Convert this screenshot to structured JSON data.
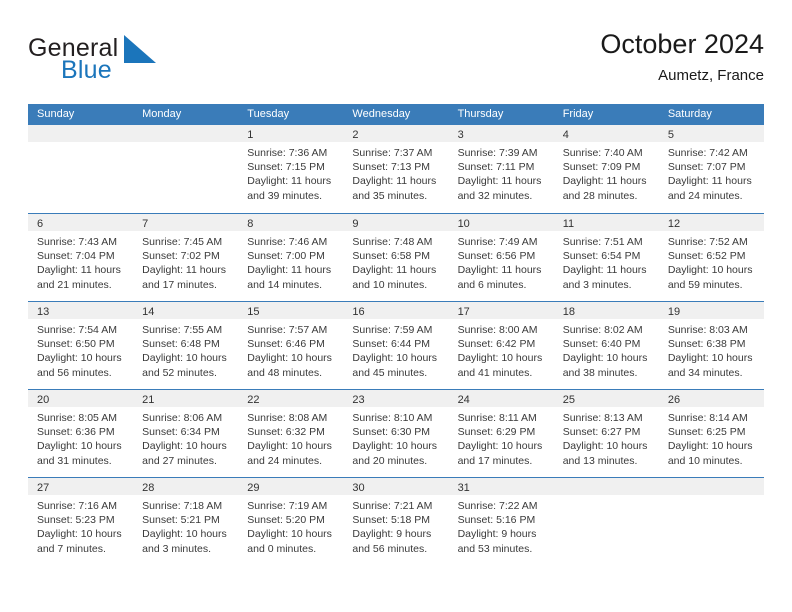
{
  "brand": {
    "name_part1": "General",
    "name_part2": "Blue",
    "logo_icon": "triangle-icon",
    "accent_color": "#1b75bb"
  },
  "header": {
    "title": "October 2024",
    "location": "Aumetz, France"
  },
  "calendar": {
    "header_color": "#3a7cb9",
    "weekdays": [
      "Sunday",
      "Monday",
      "Tuesday",
      "Wednesday",
      "Thursday",
      "Friday",
      "Saturday"
    ],
    "weeks": [
      [
        {
          "day": "",
          "lines": []
        },
        {
          "day": "",
          "lines": []
        },
        {
          "day": "1",
          "lines": [
            "Sunrise: 7:36 AM",
            "Sunset: 7:15 PM",
            "Daylight: 11 hours",
            "and 39 minutes."
          ]
        },
        {
          "day": "2",
          "lines": [
            "Sunrise: 7:37 AM",
            "Sunset: 7:13 PM",
            "Daylight: 11 hours",
            "and 35 minutes."
          ]
        },
        {
          "day": "3",
          "lines": [
            "Sunrise: 7:39 AM",
            "Sunset: 7:11 PM",
            "Daylight: 11 hours",
            "and 32 minutes."
          ]
        },
        {
          "day": "4",
          "lines": [
            "Sunrise: 7:40 AM",
            "Sunset: 7:09 PM",
            "Daylight: 11 hours",
            "and 28 minutes."
          ]
        },
        {
          "day": "5",
          "lines": [
            "Sunrise: 7:42 AM",
            "Sunset: 7:07 PM",
            "Daylight: 11 hours",
            "and 24 minutes."
          ]
        }
      ],
      [
        {
          "day": "6",
          "lines": [
            "Sunrise: 7:43 AM",
            "Sunset: 7:04 PM",
            "Daylight: 11 hours",
            "and 21 minutes."
          ]
        },
        {
          "day": "7",
          "lines": [
            "Sunrise: 7:45 AM",
            "Sunset: 7:02 PM",
            "Daylight: 11 hours",
            "and 17 minutes."
          ]
        },
        {
          "day": "8",
          "lines": [
            "Sunrise: 7:46 AM",
            "Sunset: 7:00 PM",
            "Daylight: 11 hours",
            "and 14 minutes."
          ]
        },
        {
          "day": "9",
          "lines": [
            "Sunrise: 7:48 AM",
            "Sunset: 6:58 PM",
            "Daylight: 11 hours",
            "and 10 minutes."
          ]
        },
        {
          "day": "10",
          "lines": [
            "Sunrise: 7:49 AM",
            "Sunset: 6:56 PM",
            "Daylight: 11 hours",
            "and 6 minutes."
          ]
        },
        {
          "day": "11",
          "lines": [
            "Sunrise: 7:51 AM",
            "Sunset: 6:54 PM",
            "Daylight: 11 hours",
            "and 3 minutes."
          ]
        },
        {
          "day": "12",
          "lines": [
            "Sunrise: 7:52 AM",
            "Sunset: 6:52 PM",
            "Daylight: 10 hours",
            "and 59 minutes."
          ]
        }
      ],
      [
        {
          "day": "13",
          "lines": [
            "Sunrise: 7:54 AM",
            "Sunset: 6:50 PM",
            "Daylight: 10 hours",
            "and 56 minutes."
          ]
        },
        {
          "day": "14",
          "lines": [
            "Sunrise: 7:55 AM",
            "Sunset: 6:48 PM",
            "Daylight: 10 hours",
            "and 52 minutes."
          ]
        },
        {
          "day": "15",
          "lines": [
            "Sunrise: 7:57 AM",
            "Sunset: 6:46 PM",
            "Daylight: 10 hours",
            "and 48 minutes."
          ]
        },
        {
          "day": "16",
          "lines": [
            "Sunrise: 7:59 AM",
            "Sunset: 6:44 PM",
            "Daylight: 10 hours",
            "and 45 minutes."
          ]
        },
        {
          "day": "17",
          "lines": [
            "Sunrise: 8:00 AM",
            "Sunset: 6:42 PM",
            "Daylight: 10 hours",
            "and 41 minutes."
          ]
        },
        {
          "day": "18",
          "lines": [
            "Sunrise: 8:02 AM",
            "Sunset: 6:40 PM",
            "Daylight: 10 hours",
            "and 38 minutes."
          ]
        },
        {
          "day": "19",
          "lines": [
            "Sunrise: 8:03 AM",
            "Sunset: 6:38 PM",
            "Daylight: 10 hours",
            "and 34 minutes."
          ]
        }
      ],
      [
        {
          "day": "20",
          "lines": [
            "Sunrise: 8:05 AM",
            "Sunset: 6:36 PM",
            "Daylight: 10 hours",
            "and 31 minutes."
          ]
        },
        {
          "day": "21",
          "lines": [
            "Sunrise: 8:06 AM",
            "Sunset: 6:34 PM",
            "Daylight: 10 hours",
            "and 27 minutes."
          ]
        },
        {
          "day": "22",
          "lines": [
            "Sunrise: 8:08 AM",
            "Sunset: 6:32 PM",
            "Daylight: 10 hours",
            "and 24 minutes."
          ]
        },
        {
          "day": "23",
          "lines": [
            "Sunrise: 8:10 AM",
            "Sunset: 6:30 PM",
            "Daylight: 10 hours",
            "and 20 minutes."
          ]
        },
        {
          "day": "24",
          "lines": [
            "Sunrise: 8:11 AM",
            "Sunset: 6:29 PM",
            "Daylight: 10 hours",
            "and 17 minutes."
          ]
        },
        {
          "day": "25",
          "lines": [
            "Sunrise: 8:13 AM",
            "Sunset: 6:27 PM",
            "Daylight: 10 hours",
            "and 13 minutes."
          ]
        },
        {
          "day": "26",
          "lines": [
            "Sunrise: 8:14 AM",
            "Sunset: 6:25 PM",
            "Daylight: 10 hours",
            "and 10 minutes."
          ]
        }
      ],
      [
        {
          "day": "27",
          "lines": [
            "Sunrise: 7:16 AM",
            "Sunset: 5:23 PM",
            "Daylight: 10 hours",
            "and 7 minutes."
          ]
        },
        {
          "day": "28",
          "lines": [
            "Sunrise: 7:18 AM",
            "Sunset: 5:21 PM",
            "Daylight: 10 hours",
            "and 3 minutes."
          ]
        },
        {
          "day": "29",
          "lines": [
            "Sunrise: 7:19 AM",
            "Sunset: 5:20 PM",
            "Daylight: 10 hours",
            "and 0 minutes."
          ]
        },
        {
          "day": "30",
          "lines": [
            "Sunrise: 7:21 AM",
            "Sunset: 5:18 PM",
            "Daylight: 9 hours",
            "and 56 minutes."
          ]
        },
        {
          "day": "31",
          "lines": [
            "Sunrise: 7:22 AM",
            "Sunset: 5:16 PM",
            "Daylight: 9 hours",
            "and 53 minutes."
          ]
        },
        {
          "day": "",
          "lines": []
        },
        {
          "day": "",
          "lines": []
        }
      ]
    ]
  }
}
